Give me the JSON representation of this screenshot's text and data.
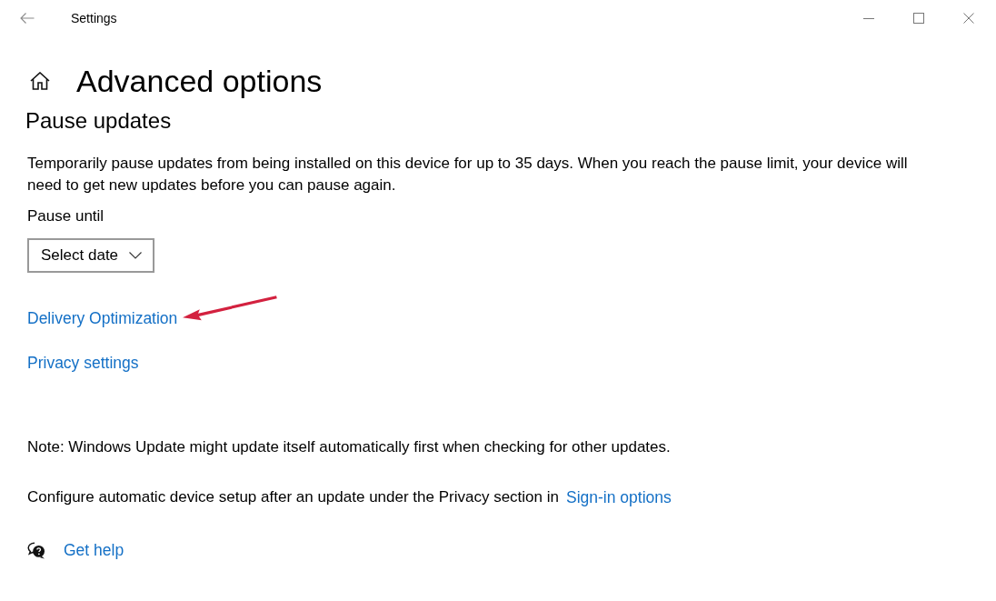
{
  "window": {
    "title": "Settings"
  },
  "page": {
    "title": "Advanced options"
  },
  "section": {
    "title": "Pause updates",
    "description": "Temporarily pause updates from being installed on this device for up to 35 days. When you reach the pause limit, your device will need to get new updates before you can pause again.",
    "pause_label": "Pause until",
    "date_select": {
      "label": "Select date"
    }
  },
  "links": [
    {
      "label": "Delivery Optimization",
      "pointed_at": true
    },
    {
      "label": "Privacy settings",
      "pointed_at": false
    }
  ],
  "note": "Note: Windows Update might update itself automatically first when checking for other updates.",
  "configure": {
    "text": "Configure automatic device setup after an update under the Privacy section in",
    "link": "Sign-in options"
  },
  "help": {
    "label": "Get help"
  }
}
